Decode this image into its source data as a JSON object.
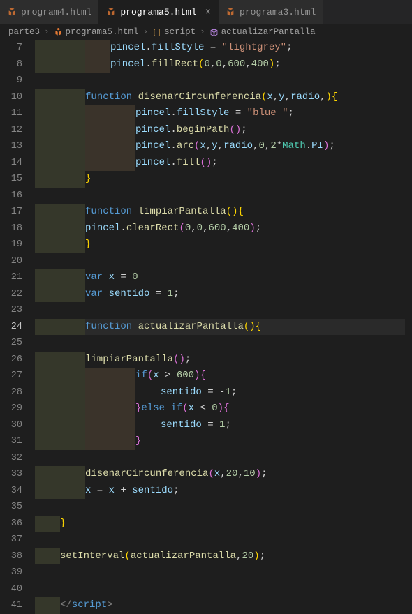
{
  "tabs": [
    {
      "label": "program4.html",
      "active": false,
      "closable": false
    },
    {
      "label": "programa5.html",
      "active": true,
      "closable": true
    },
    {
      "label": "programa3.html",
      "active": false,
      "closable": false
    }
  ],
  "breadcrumbs": {
    "parts": [
      {
        "label": "parte3",
        "icon": null
      },
      {
        "label": "programa5.html",
        "icon": "file"
      },
      {
        "label": "script",
        "icon": "brackets"
      },
      {
        "label": "actualizarPantalla",
        "icon": "cube"
      }
    ]
  },
  "currentLine": 24,
  "lines": [
    {
      "n": 7,
      "indent": 3,
      "tokens": [
        {
          "c": "tk-var",
          "t": "pincel"
        },
        {
          "c": "tk-punc",
          "t": "."
        },
        {
          "c": "tk-var",
          "t": "fillStyle"
        },
        {
          "c": "tk-op",
          "t": " = "
        },
        {
          "c": "tk-str",
          "t": "\"lightgrey\""
        },
        {
          "c": "tk-punc",
          "t": ";"
        }
      ]
    },
    {
      "n": 8,
      "indent": 3,
      "tokens": [
        {
          "c": "tk-var",
          "t": "pincel"
        },
        {
          "c": "tk-punc",
          "t": "."
        },
        {
          "c": "tk-fn",
          "t": "fillRect"
        },
        {
          "c": "tk-brace-y",
          "t": "("
        },
        {
          "c": "tk-num",
          "t": "0"
        },
        {
          "c": "tk-punc",
          "t": ","
        },
        {
          "c": "tk-num",
          "t": "0"
        },
        {
          "c": "tk-punc",
          "t": ","
        },
        {
          "c": "tk-num",
          "t": "600"
        },
        {
          "c": "tk-punc",
          "t": ","
        },
        {
          "c": "tk-num",
          "t": "400"
        },
        {
          "c": "tk-brace-y",
          "t": ")"
        },
        {
          "c": "tk-punc",
          "t": ";"
        }
      ]
    },
    {
      "n": 9,
      "indent": 0,
      "tokens": []
    },
    {
      "n": 10,
      "indent": 2,
      "tokens": [
        {
          "c": "tk-kw",
          "t": "function"
        },
        {
          "c": "tk-punc",
          "t": " "
        },
        {
          "c": "tk-fn",
          "t": "disenarCircunferencia"
        },
        {
          "c": "tk-brace-y",
          "t": "("
        },
        {
          "c": "tk-var",
          "t": "x"
        },
        {
          "c": "tk-punc",
          "t": ","
        },
        {
          "c": "tk-var",
          "t": "y"
        },
        {
          "c": "tk-punc",
          "t": ","
        },
        {
          "c": "tk-var",
          "t": "radio"
        },
        {
          "c": "tk-punc",
          "t": ","
        },
        {
          "c": "tk-brace-y",
          "t": ")"
        },
        {
          "c": "tk-brace-y",
          "t": "{"
        }
      ]
    },
    {
      "n": 11,
      "indent": 4,
      "tokens": [
        {
          "c": "tk-var",
          "t": "pincel"
        },
        {
          "c": "tk-punc",
          "t": "."
        },
        {
          "c": "tk-var",
          "t": "fillStyle"
        },
        {
          "c": "tk-op",
          "t": " = "
        },
        {
          "c": "tk-str",
          "t": "\"blue \""
        },
        {
          "c": "tk-punc",
          "t": ";"
        }
      ]
    },
    {
      "n": 12,
      "indent": 4,
      "tokens": [
        {
          "c": "tk-var",
          "t": "pincel"
        },
        {
          "c": "tk-punc",
          "t": "."
        },
        {
          "c": "tk-fn",
          "t": "beginPath"
        },
        {
          "c": "tk-brace-p",
          "t": "("
        },
        {
          "c": "tk-brace-p",
          "t": ")"
        },
        {
          "c": "tk-punc",
          "t": ";"
        }
      ]
    },
    {
      "n": 13,
      "indent": 4,
      "tokens": [
        {
          "c": "tk-var",
          "t": "pincel"
        },
        {
          "c": "tk-punc",
          "t": "."
        },
        {
          "c": "tk-fn",
          "t": "arc"
        },
        {
          "c": "tk-brace-p",
          "t": "("
        },
        {
          "c": "tk-var",
          "t": "x"
        },
        {
          "c": "tk-punc",
          "t": ","
        },
        {
          "c": "tk-var",
          "t": "y"
        },
        {
          "c": "tk-punc",
          "t": ","
        },
        {
          "c": "tk-var",
          "t": "radio"
        },
        {
          "c": "tk-punc",
          "t": ","
        },
        {
          "c": "tk-num",
          "t": "0"
        },
        {
          "c": "tk-punc",
          "t": ","
        },
        {
          "c": "tk-num",
          "t": "2"
        },
        {
          "c": "tk-op",
          "t": "*"
        },
        {
          "c": "tk-obj",
          "t": "Math"
        },
        {
          "c": "tk-punc",
          "t": "."
        },
        {
          "c": "tk-var",
          "t": "PI"
        },
        {
          "c": "tk-brace-p",
          "t": ")"
        },
        {
          "c": "tk-punc",
          "t": ";"
        }
      ]
    },
    {
      "n": 14,
      "indent": 4,
      "tokens": [
        {
          "c": "tk-var",
          "t": "pincel"
        },
        {
          "c": "tk-punc",
          "t": "."
        },
        {
          "c": "tk-fn",
          "t": "fill"
        },
        {
          "c": "tk-brace-p",
          "t": "("
        },
        {
          "c": "tk-brace-p",
          "t": ")"
        },
        {
          "c": "tk-punc",
          "t": ";"
        }
      ]
    },
    {
      "n": 15,
      "indent": 2,
      "tokens": [
        {
          "c": "tk-brace-y",
          "t": "}"
        }
      ]
    },
    {
      "n": 16,
      "indent": 0,
      "tokens": []
    },
    {
      "n": 17,
      "indent": 2,
      "tokens": [
        {
          "c": "tk-kw",
          "t": "function"
        },
        {
          "c": "tk-punc",
          "t": " "
        },
        {
          "c": "tk-fn",
          "t": "limpiarPantalla"
        },
        {
          "c": "tk-brace-y",
          "t": "("
        },
        {
          "c": "tk-brace-y",
          "t": ")"
        },
        {
          "c": "tk-brace-y",
          "t": "{"
        }
      ]
    },
    {
      "n": 18,
      "indent": 2,
      "tokens": [
        {
          "c": "tk-var",
          "t": "pincel"
        },
        {
          "c": "tk-punc",
          "t": "."
        },
        {
          "c": "tk-fn",
          "t": "clearRect"
        },
        {
          "c": "tk-brace-p",
          "t": "("
        },
        {
          "c": "tk-num",
          "t": "0"
        },
        {
          "c": "tk-punc",
          "t": ","
        },
        {
          "c": "tk-num",
          "t": "0"
        },
        {
          "c": "tk-punc",
          "t": ","
        },
        {
          "c": "tk-num",
          "t": "600"
        },
        {
          "c": "tk-punc",
          "t": ","
        },
        {
          "c": "tk-num",
          "t": "400"
        },
        {
          "c": "tk-brace-p",
          "t": ")"
        },
        {
          "c": "tk-punc",
          "t": ";"
        }
      ]
    },
    {
      "n": 19,
      "indent": 2,
      "tokens": [
        {
          "c": "tk-brace-y",
          "t": "}"
        }
      ]
    },
    {
      "n": 20,
      "indent": 0,
      "tokens": []
    },
    {
      "n": 21,
      "indent": 2,
      "tokens": [
        {
          "c": "tk-kw",
          "t": "var"
        },
        {
          "c": "tk-punc",
          "t": " "
        },
        {
          "c": "tk-var",
          "t": "x"
        },
        {
          "c": "tk-op",
          "t": " = "
        },
        {
          "c": "tk-num",
          "t": "0"
        }
      ]
    },
    {
      "n": 22,
      "indent": 2,
      "tokens": [
        {
          "c": "tk-kw",
          "t": "var"
        },
        {
          "c": "tk-punc",
          "t": " "
        },
        {
          "c": "tk-var",
          "t": "sentido"
        },
        {
          "c": "tk-op",
          "t": " = "
        },
        {
          "c": "tk-num",
          "t": "1"
        },
        {
          "c": "tk-punc",
          "t": ";"
        }
      ]
    },
    {
      "n": 23,
      "indent": 0,
      "tokens": []
    },
    {
      "n": 24,
      "indent": 2,
      "tokens": [
        {
          "c": "tk-kw",
          "t": "function"
        },
        {
          "c": "tk-punc",
          "t": " "
        },
        {
          "c": "tk-fn",
          "t": "actualizarPantalla"
        },
        {
          "c": "tk-brace-y",
          "t": "("
        },
        {
          "c": "tk-brace-y",
          "t": ")"
        },
        {
          "c": "tk-brace-y",
          "t": "{"
        }
      ]
    },
    {
      "n": 25,
      "indent": 0,
      "tokens": []
    },
    {
      "n": 26,
      "indent": 2,
      "tokens": [
        {
          "c": "tk-fn",
          "t": "limpiarPantalla"
        },
        {
          "c": "tk-brace-p",
          "t": "("
        },
        {
          "c": "tk-brace-p",
          "t": ")"
        },
        {
          "c": "tk-punc",
          "t": ";"
        }
      ]
    },
    {
      "n": 27,
      "indent": 4,
      "tokens": [
        {
          "c": "tk-kw",
          "t": "if"
        },
        {
          "c": "tk-brace-p",
          "t": "("
        },
        {
          "c": "tk-var",
          "t": "x"
        },
        {
          "c": "tk-op",
          "t": " > "
        },
        {
          "c": "tk-num",
          "t": "600"
        },
        {
          "c": "tk-brace-p",
          "t": ")"
        },
        {
          "c": "tk-brace-p",
          "t": "{"
        }
      ]
    },
    {
      "n": 28,
      "indent": 5,
      "tokens": [
        {
          "c": "tk-var",
          "t": "sentido"
        },
        {
          "c": "tk-op",
          "t": " = "
        },
        {
          "c": "tk-op",
          "t": "-"
        },
        {
          "c": "tk-num",
          "t": "1"
        },
        {
          "c": "tk-punc",
          "t": ";"
        }
      ]
    },
    {
      "n": 29,
      "indent": 4,
      "tokens": [
        {
          "c": "tk-brace-p",
          "t": "}"
        },
        {
          "c": "tk-kw",
          "t": "else"
        },
        {
          "c": "tk-punc",
          "t": " "
        },
        {
          "c": "tk-kw",
          "t": "if"
        },
        {
          "c": "tk-brace-p",
          "t": "("
        },
        {
          "c": "tk-var",
          "t": "x"
        },
        {
          "c": "tk-op",
          "t": " < "
        },
        {
          "c": "tk-num",
          "t": "0"
        },
        {
          "c": "tk-brace-p",
          "t": ")"
        },
        {
          "c": "tk-brace-p",
          "t": "{"
        }
      ]
    },
    {
      "n": 30,
      "indent": 5,
      "tokens": [
        {
          "c": "tk-var",
          "t": "sentido"
        },
        {
          "c": "tk-op",
          "t": " = "
        },
        {
          "c": "tk-num",
          "t": "1"
        },
        {
          "c": "tk-punc",
          "t": ";"
        }
      ]
    },
    {
      "n": 31,
      "indent": 4,
      "tokens": [
        {
          "c": "tk-brace-p",
          "t": "}"
        }
      ]
    },
    {
      "n": 32,
      "indent": 0,
      "tokens": []
    },
    {
      "n": 33,
      "indent": 2,
      "tokens": [
        {
          "c": "tk-fn",
          "t": "disenarCircunferencia"
        },
        {
          "c": "tk-brace-p",
          "t": "("
        },
        {
          "c": "tk-var",
          "t": "x"
        },
        {
          "c": "tk-punc",
          "t": ","
        },
        {
          "c": "tk-num",
          "t": "20"
        },
        {
          "c": "tk-punc",
          "t": ","
        },
        {
          "c": "tk-num",
          "t": "10"
        },
        {
          "c": "tk-brace-p",
          "t": ")"
        },
        {
          "c": "tk-punc",
          "t": ";"
        }
      ]
    },
    {
      "n": 34,
      "indent": 2,
      "tokens": [
        {
          "c": "tk-var",
          "t": "x"
        },
        {
          "c": "tk-op",
          "t": " = "
        },
        {
          "c": "tk-var",
          "t": "x"
        },
        {
          "c": "tk-op",
          "t": " + "
        },
        {
          "c": "tk-var",
          "t": "sentido"
        },
        {
          "c": "tk-punc",
          "t": ";"
        }
      ]
    },
    {
      "n": 35,
      "indent": 0,
      "tokens": []
    },
    {
      "n": 36,
      "indent": 1,
      "tokens": [
        {
          "c": "tk-brace-y",
          "t": "}"
        }
      ]
    },
    {
      "n": 37,
      "indent": 0,
      "tokens": []
    },
    {
      "n": 38,
      "indent": 1,
      "tokens": [
        {
          "c": "tk-fn",
          "t": "setInterval"
        },
        {
          "c": "tk-brace-y",
          "t": "("
        },
        {
          "c": "tk-fn",
          "t": "actualizarPantalla"
        },
        {
          "c": "tk-punc",
          "t": ","
        },
        {
          "c": "tk-num",
          "t": "20"
        },
        {
          "c": "tk-brace-y",
          "t": ")"
        },
        {
          "c": "tk-punc",
          "t": ";"
        }
      ]
    },
    {
      "n": 39,
      "indent": 0,
      "tokens": []
    },
    {
      "n": 40,
      "indent": 0,
      "tokens": []
    },
    {
      "n": 41,
      "indent": 1,
      "tokens": [
        {
          "c": "tk-tag",
          "t": "</"
        },
        {
          "c": "tk-tagname",
          "t": "script"
        },
        {
          "c": "tk-tag",
          "t": ">"
        }
      ]
    }
  ]
}
